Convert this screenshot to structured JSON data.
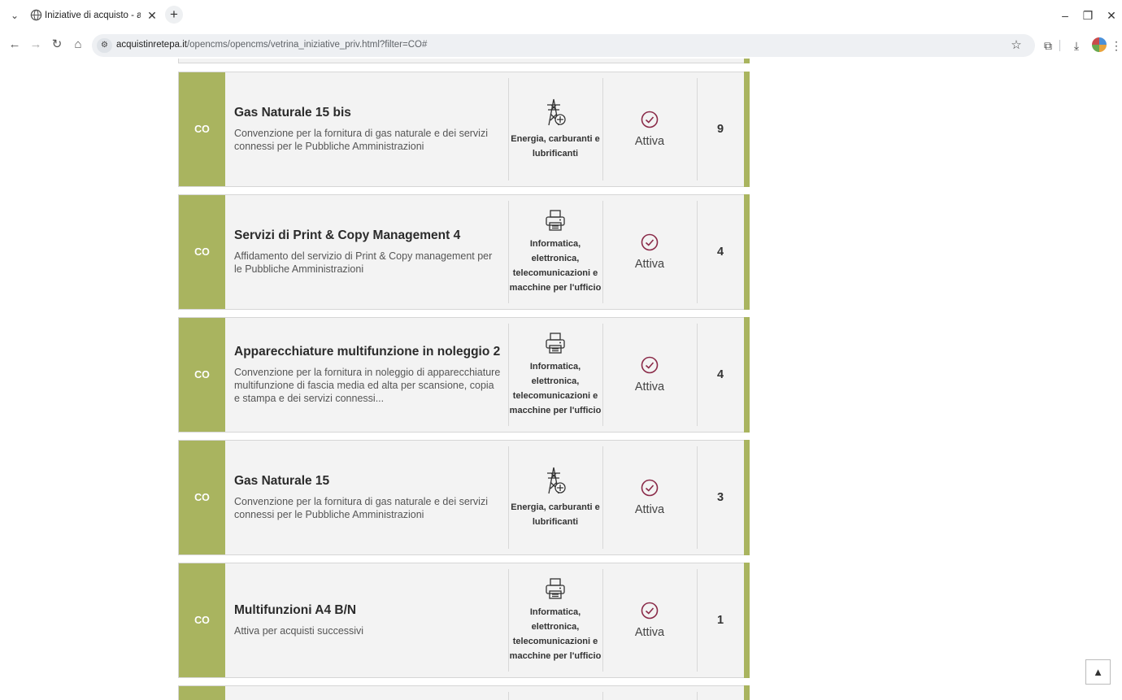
{
  "browser": {
    "tab_title": "Iniziative di acquisto - acquistin",
    "url_domain": "acquistinretepa.it",
    "url_path": "/opencms/opencms/vetrina_iniziative_priv.html?filter=CO#"
  },
  "cards": [
    {
      "code": "CO",
      "title": "Gas Naturale 15 bis",
      "description": "Convenzione per la fornitura di gas naturale e dei servizi connessi per le Pubbliche Amministrazioni",
      "category_icon": "power-tower-icon",
      "category": "Energia, carburanti e lubrificanti",
      "status": "Attiva",
      "count": "9"
    },
    {
      "code": "CO",
      "title": "Servizi di Print & Copy Management 4",
      "description": "Affidamento del servizio di Print & Copy management per le Pubbliche Amministrazioni",
      "category_icon": "printer-icon",
      "category": "Informatica, elettronica, telecomunicazioni e macchine per l'ufficio",
      "status": "Attiva",
      "count": "4"
    },
    {
      "code": "CO",
      "title": "Apparecchiature multifunzione in noleggio 2",
      "description": "Convenzione per la fornitura in noleggio di apparecchiature multifunzione di fascia media ed alta per scansione, copia e stampa e dei servizi connessi...",
      "category_icon": "printer-icon",
      "category": "Informatica, elettronica, telecomunicazioni e macchine per l'ufficio",
      "status": "Attiva",
      "count": "4"
    },
    {
      "code": "CO",
      "title": "Gas Naturale 15",
      "description": "Convenzione per la fornitura di gas naturale e dei servizi connessi per le Pubbliche Amministrazioni",
      "category_icon": "power-tower-icon",
      "category": "Energia, carburanti e lubrificanti",
      "status": "Attiva",
      "count": "3"
    },
    {
      "code": "CO",
      "title": "Multifunzioni A4 B/N",
      "description": "Attiva per acquisti successivi",
      "category_icon": "printer-icon",
      "category": "Informatica, elettronica, telecomunicazioni e macchine per l'ufficio",
      "status": "Attiva",
      "count": "1"
    }
  ],
  "colors": {
    "accent": "#a9b45f",
    "status_icon": "#8a2a48",
    "card_bg": "#f3f3f3"
  }
}
